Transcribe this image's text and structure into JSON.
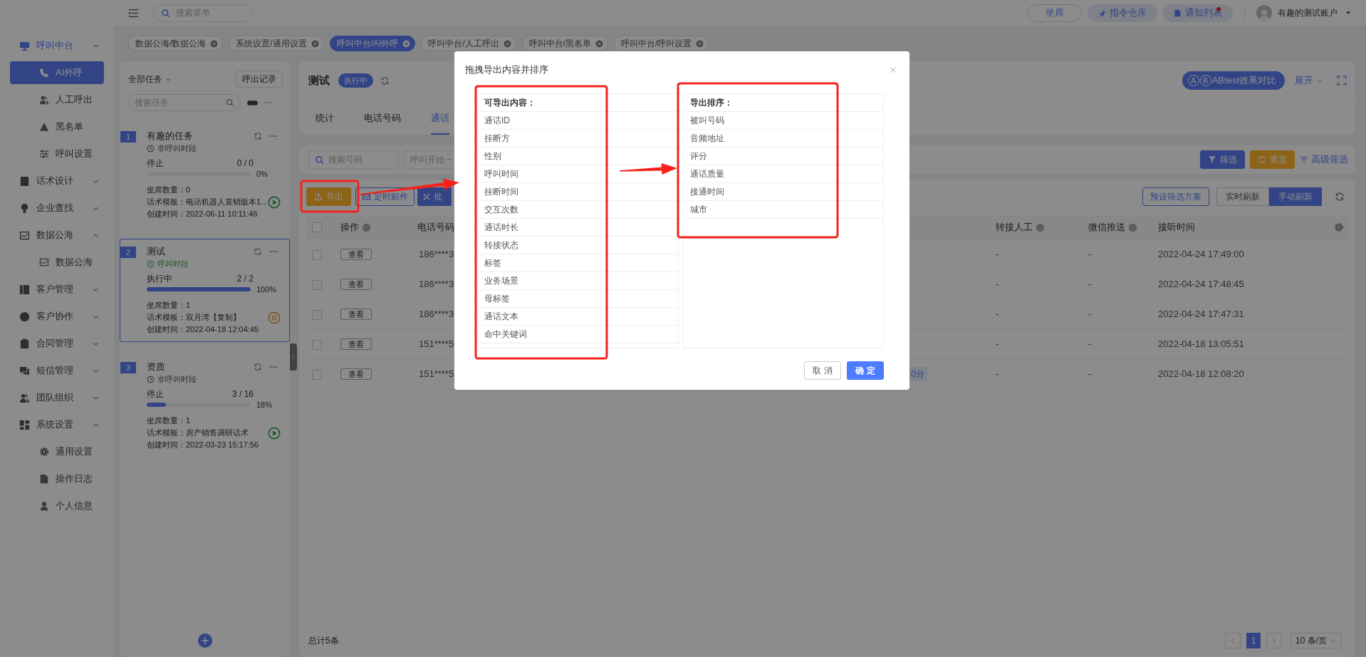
{
  "header": {
    "search_placeholder": "搜索菜单",
    "buttons": [
      {
        "label": "坐席",
        "kind": "outline",
        "badge": false
      },
      {
        "label": "指令仓库",
        "kind": "pin",
        "badge": false
      },
      {
        "label": "通知列表",
        "kind": "doc",
        "badge": true
      }
    ],
    "user": "有趣的测试账户"
  },
  "sidebar": {
    "items": [
      {
        "label": "呼叫中台",
        "active": true,
        "expanded": true,
        "children": [
          {
            "label": "AI外呼",
            "selected": true
          },
          {
            "label": "人工呼出",
            "selected": false
          },
          {
            "label": "黑名单",
            "selected": false
          },
          {
            "label": "呼叫设置",
            "selected": false
          }
        ]
      },
      {
        "label": "话术设计",
        "active": false,
        "expanded": false
      },
      {
        "label": "企业查找",
        "active": false,
        "expanded": false
      },
      {
        "label": "数据公海",
        "active": false,
        "expanded": true,
        "children": [
          {
            "label": "数据公海",
            "selected": false
          }
        ]
      },
      {
        "label": "客户管理",
        "active": false,
        "expanded": false
      },
      {
        "label": "客户协作",
        "active": false,
        "expanded": false
      },
      {
        "label": "合同管理",
        "active": false,
        "expanded": false
      },
      {
        "label": "短信管理",
        "active": false,
        "expanded": false
      },
      {
        "label": "团队组织",
        "active": false,
        "expanded": false
      },
      {
        "label": "系统设置",
        "active": false,
        "expanded": true,
        "children": [
          {
            "label": "通用设置",
            "selected": false
          },
          {
            "label": "操作日志",
            "selected": false
          },
          {
            "label": "个人信息",
            "selected": false
          }
        ]
      }
    ]
  },
  "tags": [
    {
      "label": "数据公海/数据公海",
      "selected": false
    },
    {
      "label": "系统设置/通用设置",
      "selected": false
    },
    {
      "label": "呼叫中台/AI外呼",
      "selected": true
    },
    {
      "label": "呼叫中台/人工呼出",
      "selected": false
    },
    {
      "label": "呼叫中台/黑名单",
      "selected": false
    },
    {
      "label": "呼叫中台/呼叫设置",
      "selected": false
    }
  ],
  "task_panel": {
    "filter": "全部任务",
    "record_button": "呼出记录",
    "search_placeholder": "搜索任务",
    "tasks": [
      {
        "number": "1",
        "name": "有趣的任务",
        "period": "非呼叫时段",
        "in_period": false,
        "status": "停止",
        "progress": "0 / 0",
        "level": 0,
        "percent": "0%",
        "fields": [
          {
            "label": "坐席数量：",
            "value": "0"
          },
          {
            "label": "话术模板：",
            "value": "电话机器人直销版本1..."
          },
          {
            "label": "创建时间：",
            "value": "2022-06-11 10:11:46"
          }
        ],
        "running": false,
        "selected": false
      },
      {
        "number": "2",
        "name": "测试",
        "period": "呼叫时段",
        "in_period": true,
        "status": "执行中",
        "progress": "2 / 2",
        "level": 1,
        "percent": "100%",
        "fields": [
          {
            "label": "坐席数量：",
            "value": "1"
          },
          {
            "label": "话术模板：",
            "value": "双月湾【复制】"
          },
          {
            "label": "创建时间：",
            "value": "2022-04-18 12:04:45"
          }
        ],
        "running": true,
        "selected": true
      },
      {
        "number": "3",
        "name": "资质",
        "period": "非呼叫时段",
        "in_period": false,
        "status": "停止",
        "progress": "3 / 16",
        "level": 0.1875,
        "percent": "18%",
        "fields": [
          {
            "label": "坐席数量：",
            "value": "1"
          },
          {
            "label": "话术模板：",
            "value": "房产销售调研话术"
          },
          {
            "label": "创建时间：",
            "value": "2022-03-23 15:17:56"
          }
        ],
        "running": false,
        "selected": false
      }
    ]
  },
  "task_header": {
    "title": "测试",
    "status": "执行中",
    "ab_marks": [
      "A",
      "B"
    ],
    "ab_button": "ABtest效果对比",
    "expand": "展开"
  },
  "tabs": [
    {
      "label": "统计",
      "selected": false
    },
    {
      "label": "电话号码",
      "selected": false
    },
    {
      "label": "通话",
      "selected": true
    }
  ],
  "filters": {
    "search_placeholder": "搜索号码",
    "date_placeholder": "呼叫开始 ~",
    "filter_button": "筛选",
    "reset_button": "重置",
    "advanced": "高级筛选"
  },
  "toolbar": {
    "export": "导出",
    "schedule": "定时邮件",
    "batch": "批",
    "preset": "预设筛选方案",
    "modes": [
      {
        "label": "实时刷新",
        "selected": false
      },
      {
        "label": "手动刷新",
        "selected": true
      }
    ]
  },
  "table": {
    "select_all_checked": false,
    "columns": [
      {
        "label": "操作",
        "help": true
      },
      {
        "label": "电话号码",
        "help": false
      },
      {
        "label": "转接人工",
        "help": true
      },
      {
        "label": "微信推送",
        "help": true
      },
      {
        "label": "接听时间",
        "help": false
      }
    ],
    "rows": [
      {
        "checked": false,
        "action": "查看",
        "phone": "186****3",
        "transfer": "-",
        "wechat": "-",
        "answered": "2022-04-24 17:49:00"
      },
      {
        "checked": false,
        "action": "查看",
        "phone": "186****3",
        "transfer": "-",
        "wechat": "-",
        "answered": "2022-04-24 17:48:45"
      },
      {
        "checked": false,
        "action": "查看",
        "phone": "186****3",
        "transfer": "-",
        "wechat": "-",
        "answered": "2022-04-24 17:47:31"
      },
      {
        "checked": false,
        "action": "查看",
        "phone": "151****5",
        "transfer": "-",
        "wechat": "-",
        "answered": "2022-04-18 13:05:51"
      },
      {
        "checked": false,
        "action": "查看",
        "phone": "151****5",
        "score": "0分",
        "transfer": "-",
        "wechat": "-",
        "answered": "2022-04-18 12:08:20"
      }
    ]
  },
  "footer": {
    "total": "总计5条",
    "pages": [
      {
        "label": "1",
        "selected": true
      }
    ],
    "page_size": "10 条/页"
  },
  "modal": {
    "title": "拖拽导出内容并排序",
    "available": {
      "title": "可导出内容：",
      "items": [
        "通话ID",
        "挂断方",
        "性别",
        "呼叫时间",
        "挂断时间",
        "交互次数",
        "通话时长",
        "转接状态",
        "标签",
        "业务场景",
        "母标签",
        "通话文本",
        "命中关键词"
      ]
    },
    "export_order": {
      "title": "导出排序：",
      "items": [
        "被叫号码",
        "音频地址",
        "评分",
        "通话质量",
        "接通时间",
        "城市"
      ]
    },
    "cancel": "取 消",
    "ok": "确 定"
  }
}
